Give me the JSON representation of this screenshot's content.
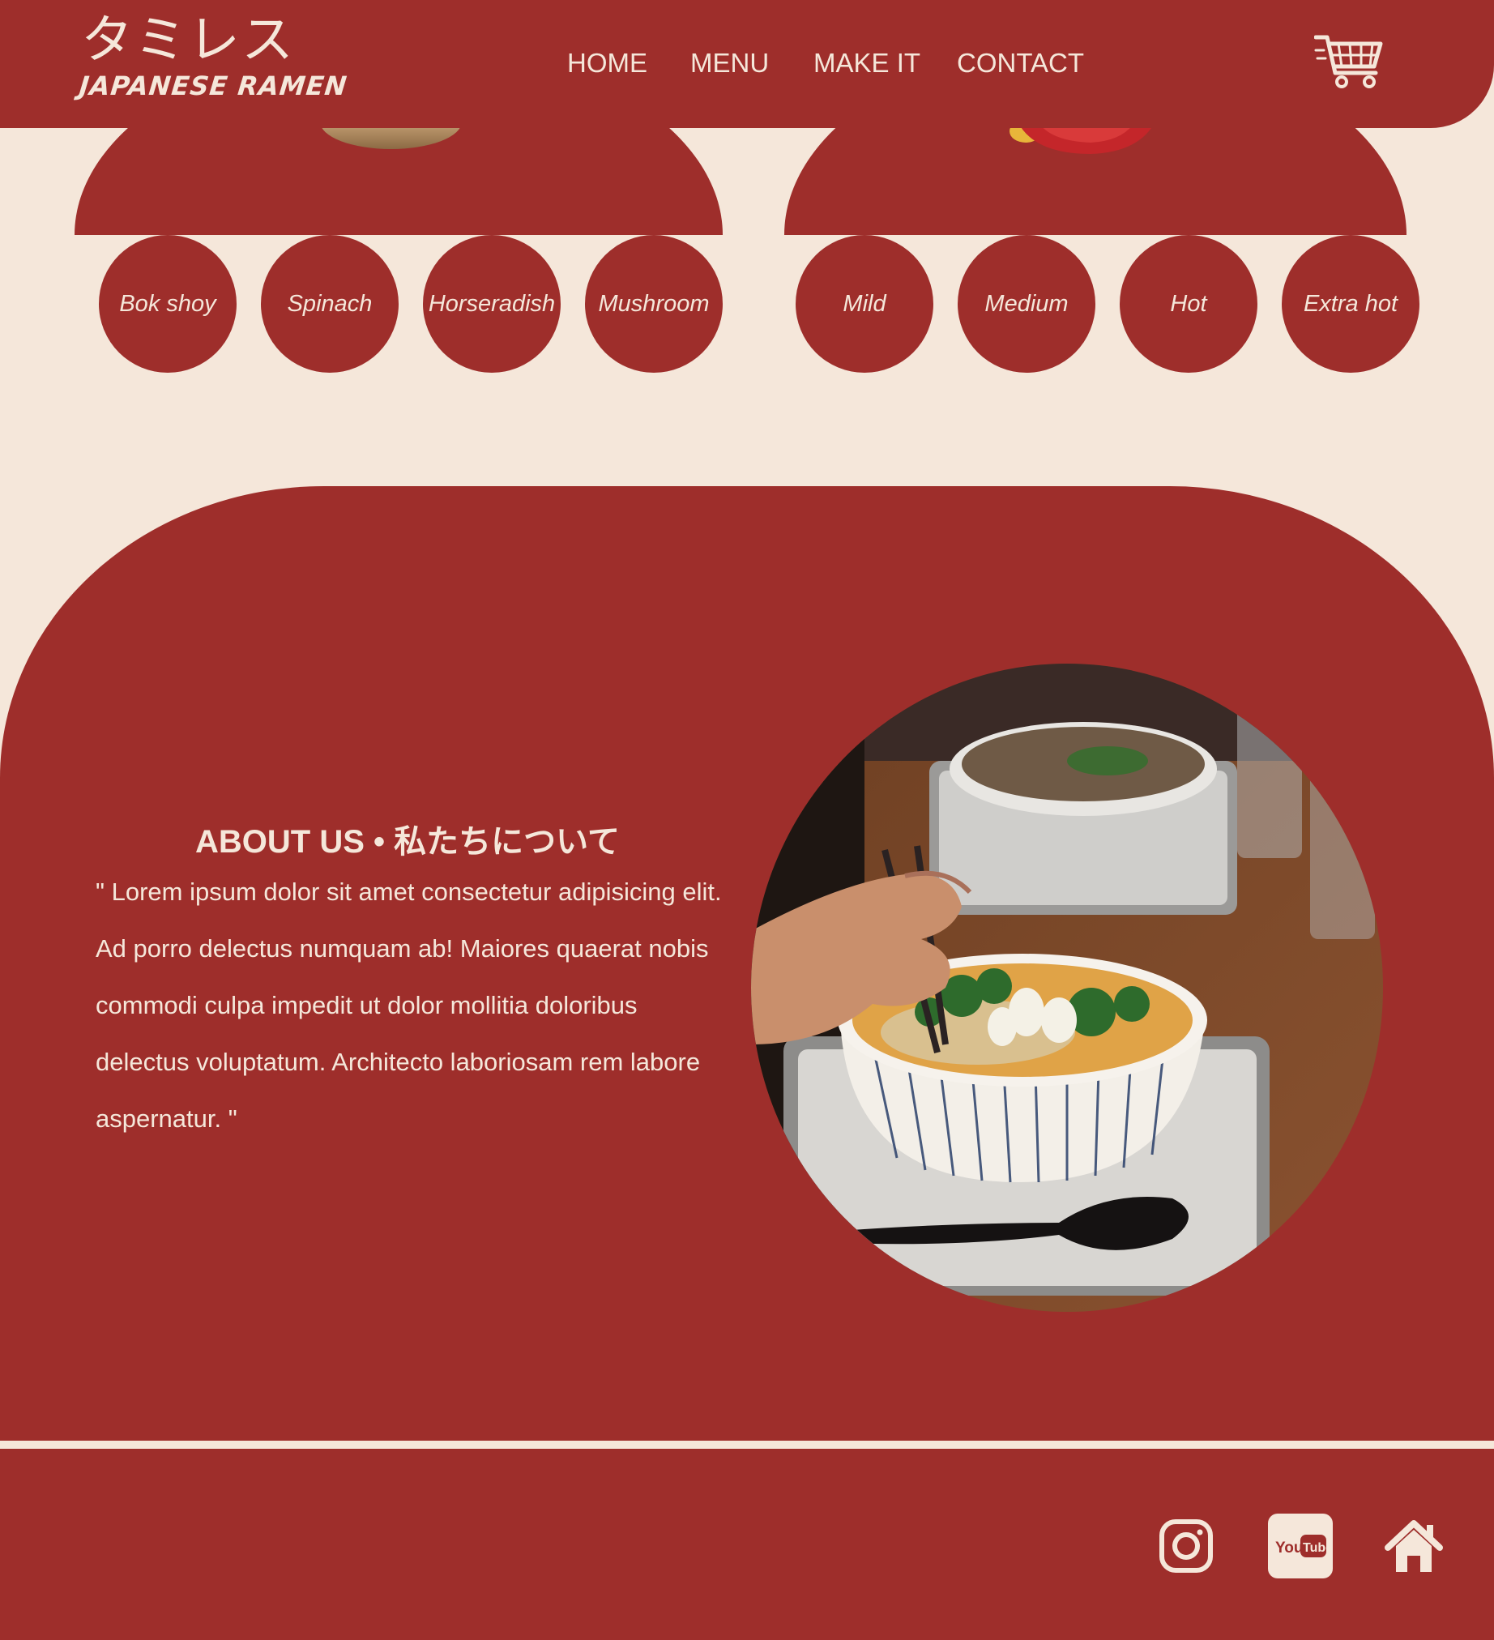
{
  "brand": {
    "name_jp": "タミレス",
    "name_en": "JAPANESE RAMEN"
  },
  "nav": {
    "items": [
      "HOME",
      "MENU",
      "MAKE IT",
      "CONTACT"
    ]
  },
  "icons": {
    "cart": "shopping-cart-icon",
    "instagram": "instagram-icon",
    "youtube": "youtube-icon",
    "home": "home-icon"
  },
  "toppings": {
    "options": [
      "Bok shoy",
      "Spinach",
      "Horseradish",
      "Mushroom"
    ]
  },
  "spice": {
    "options": [
      "Mild",
      "Medium",
      "Hot",
      "Extra hot"
    ]
  },
  "about": {
    "title": "ABOUT US • 私たちについて",
    "text": "\" Lorem ipsum dolor sit amet consectetur adipisicing elit. Ad porro delectus numquam ab! Maiores quaerat nobis commodi culpa impedit ut dolor mollitia doloribus delectus voluptatum. Architecto laboriosam rem labore aspernatur. \""
  },
  "footer": {
    "youtube_label": "YouTube"
  },
  "colors": {
    "primary": "#9e2e2b",
    "cream": "#f5e7da"
  }
}
